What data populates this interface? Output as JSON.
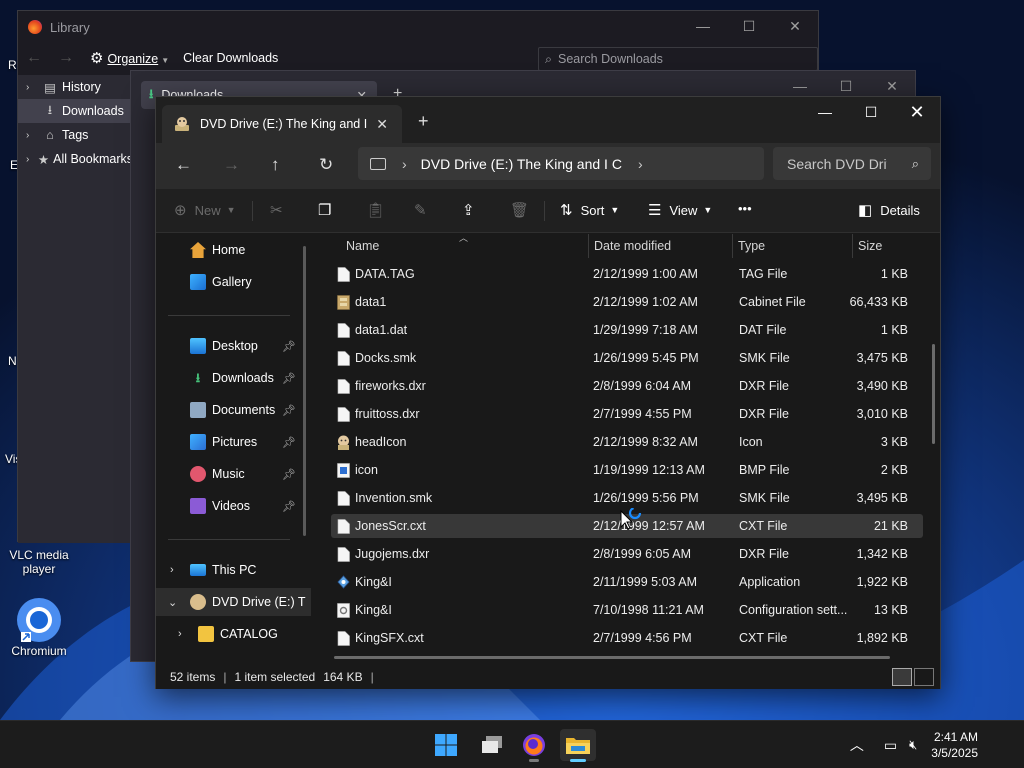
{
  "desktop": {
    "vlc_label_1": "VLC media",
    "vlc_label_2": "player",
    "chromium_label": "Chromium",
    "frag_r": "R",
    "frag_e": "E",
    "frag_n": "N",
    "frag_vis": "Vis"
  },
  "library": {
    "title": "Library",
    "organize": "Organize",
    "clear_downloads": "Clear Downloads",
    "search_placeholder": "Search Downloads",
    "tree": [
      "History",
      "Downloads",
      "Tags",
      "All Bookmarks"
    ]
  },
  "firefox": {
    "tab_title": "Downloads"
  },
  "explorer": {
    "tab_title": "DVD Drive (E:) The King and I C",
    "address_text": "DVD Drive (E:) The King and I C",
    "search_placeholder": "Search DVD Drive (E:) The King and I C",
    "cmd": {
      "new": "New",
      "sort": "Sort",
      "view": "View",
      "more": "•••",
      "details": "Details"
    },
    "nav": {
      "home": "Home",
      "gallery": "Gallery",
      "desktop": "Desktop",
      "downloads": "Downloads",
      "documents": "Documents",
      "pictures": "Pictures",
      "music": "Music",
      "videos": "Videos",
      "this_pc": "This PC",
      "dvd_drive": "DVD Drive (E:) T",
      "catalog": "CATALOG"
    },
    "columns": {
      "name": "Name",
      "date": "Date modified",
      "type": "Type",
      "size": "Size"
    },
    "files": [
      {
        "name": "DATA.TAG",
        "date": "2/12/1999 1:00 AM",
        "type": "TAG File",
        "size": "1 KB",
        "icon": "file"
      },
      {
        "name": "data1",
        "date": "2/12/1999 1:02 AM",
        "type": "Cabinet File",
        "size": "66,433 KB",
        "icon": "cabinet"
      },
      {
        "name": "data1.dat",
        "date": "1/29/1999 7:18 AM",
        "type": "DAT File",
        "size": "1 KB",
        "icon": "file"
      },
      {
        "name": "Docks.smk",
        "date": "1/26/1999 5:45 PM",
        "type": "SMK File",
        "size": "3,475 KB",
        "icon": "file"
      },
      {
        "name": "fireworks.dxr",
        "date": "2/8/1999 6:04 AM",
        "type": "DXR File",
        "size": "3,490 KB",
        "icon": "file"
      },
      {
        "name": "fruittoss.dxr",
        "date": "2/7/1999 4:55 PM",
        "type": "DXR File",
        "size": "3,010 KB",
        "icon": "file"
      },
      {
        "name": "headIcon",
        "date": "2/12/1999 8:32 AM",
        "type": "Icon",
        "size": "3 KB",
        "icon": "face"
      },
      {
        "name": "icon",
        "date": "1/19/1999 12:13 AM",
        "type": "BMP File",
        "size": "2 KB",
        "icon": "bmp"
      },
      {
        "name": "Invention.smk",
        "date": "1/26/1999 5:56 PM",
        "type": "SMK File",
        "size": "3,495 KB",
        "icon": "file"
      },
      {
        "name": "JonesScr.cxt",
        "date": "2/12/1999 12:57 AM",
        "type": "CXT File",
        "size": "21 KB",
        "icon": "file",
        "selected": true
      },
      {
        "name": "Jugojems.dxr",
        "date": "2/8/1999 6:05 AM",
        "type": "DXR File",
        "size": "1,342 KB",
        "icon": "file"
      },
      {
        "name": "King&I",
        "date": "2/11/1999 5:03 AM",
        "type": "Application",
        "size": "1,922 KB",
        "icon": "app"
      },
      {
        "name": "King&I",
        "date": "7/10/1998 11:21 AM",
        "type": "Configuration sett...",
        "size": "13 KB",
        "icon": "config"
      },
      {
        "name": "KingSFX.cxt",
        "date": "2/7/1999 4:56 PM",
        "type": "CXT File",
        "size": "1,892 KB",
        "icon": "file"
      }
    ],
    "status": {
      "count": "52 items",
      "selection": "1 item selected",
      "size": "164 KB",
      "bar": "|"
    }
  },
  "taskbar": {
    "time": "2:41 AM",
    "date": "3/5/2025"
  }
}
